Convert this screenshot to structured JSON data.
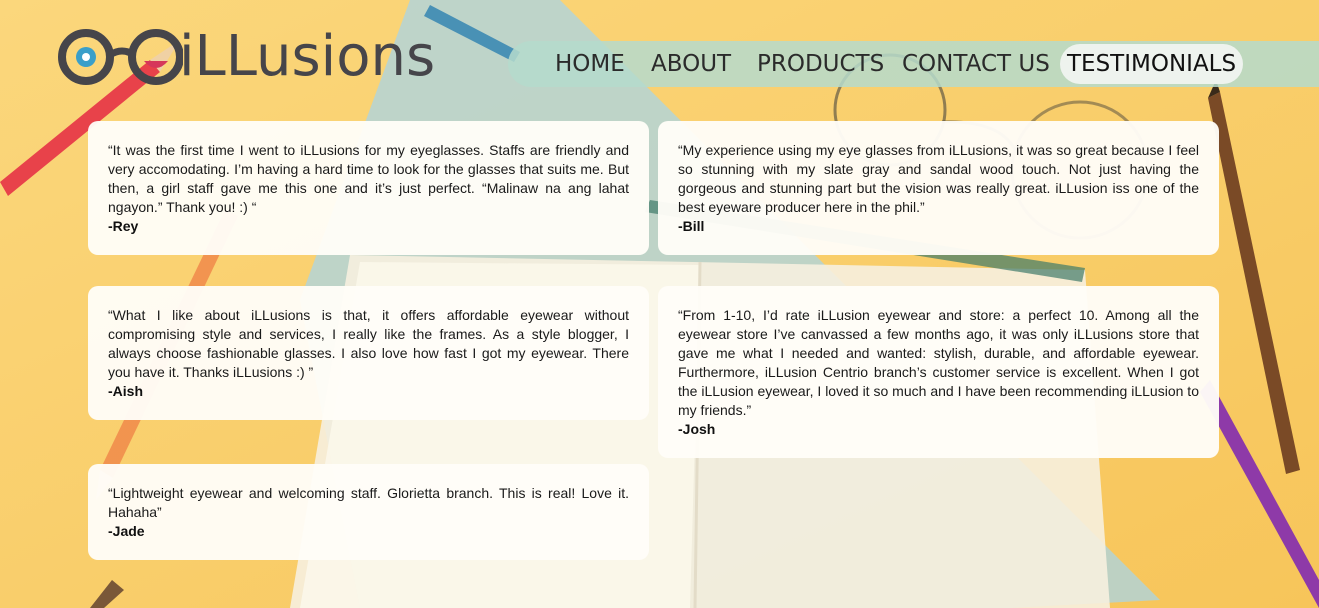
{
  "brand": {
    "name": "iLLusions",
    "logo_icon": "eyeglasses-logo-icon"
  },
  "nav": {
    "items": [
      {
        "label": "HOME"
      },
      {
        "label": "ABOUT"
      },
      {
        "label": "PRODUCTS"
      },
      {
        "label": "CONTACT US"
      },
      {
        "label": "TESTIMONIALS"
      }
    ],
    "active": "TESTIMONIALS"
  },
  "testimonials": [
    {
      "quote": "“It was the first time I went to iLLusions for my eyeglasses. Staffs are friendly and very accomodating. I’m having a hard time to look for the glasses that suits me. But then, a girl staff gave me this one and it’s just perfect. “Malinaw na ang lahat ngayon.” Thank you! :) “",
      "author": "-Rey"
    },
    {
      "quote": "“My experience using my eye glasses from iLLusions, it was so great because I feel so stunning with my slate gray and sandal wood touch. Not just having the gorgeous and stunning part but the vision was really great. iLLusion iss one of the best eyeware producer here in the phil.”",
      "author": "-Bill"
    },
    {
      "quote": "“What I like about iLLusions is that, it offers affordable eyewear without compromising style and services, I really like the frames. As a style blogger, I always choose fashionable glasses. I also love how fast I got my eyewear. There you have it. Thanks iLLusions :) ”",
      "author": "-Aish"
    },
    {
      "quote": "“From 1-10, I’d rate iLLusion eyewear and store: a perfect 10. Among all the eyewear store I’ve canvassed a few months ago, it was only iLLusions store that gave me what I needed and wanted: stylish, durable, and affordable eyewear. Furthermore, iLLusion Centrio branch’s customer service is excellent. When I got the iLLusion eyewear, I loved it so much and I have been recommending iLLusion to my friends.”",
      "author": "-Josh"
    },
    {
      "quote": "“Lightweight eyewear and welcoming staff. Glorietta branch. This is real! Love it. Hahaha”",
      "author": "-Jade"
    }
  ],
  "colors": {
    "background": "#f9cf6a",
    "navbar": "#b5dacd",
    "active_tab": "#eef3ee",
    "card": "#fffdf8",
    "logo_text": "#46454a",
    "logo_accent": "#3a9fc9"
  }
}
